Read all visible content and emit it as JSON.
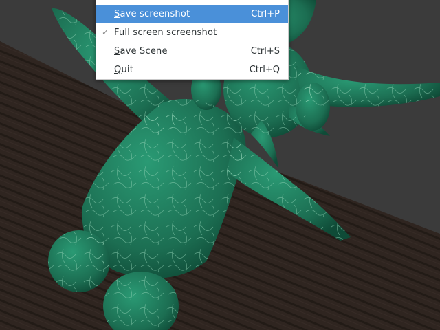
{
  "menu": {
    "items": [
      {
        "mnemonic": "",
        "label": "",
        "accel": "",
        "checked": false,
        "highlighted": false
      },
      {
        "mnemonic": "S",
        "label": "ave screenshot",
        "accel": "Ctrl+P",
        "checked": false,
        "highlighted": true
      },
      {
        "mnemonic": "F",
        "label": "ull screen screenshot",
        "accel": "",
        "checked": true,
        "highlighted": false
      },
      {
        "mnemonic": "S",
        "label": "ave Scene",
        "accel": "Ctrl+S",
        "checked": false,
        "highlighted": false
      },
      {
        "mnemonic": "Q",
        "label": "uit",
        "accel": "Ctrl+Q",
        "checked": false,
        "highlighted": false
      }
    ],
    "check_glyph": "✓"
  },
  "colors": {
    "viewport_background": "#3b3b3b",
    "floor_wood": "#3d302a",
    "model_green": "#1f7a5c",
    "menu_highlight": "#4a90d9"
  }
}
